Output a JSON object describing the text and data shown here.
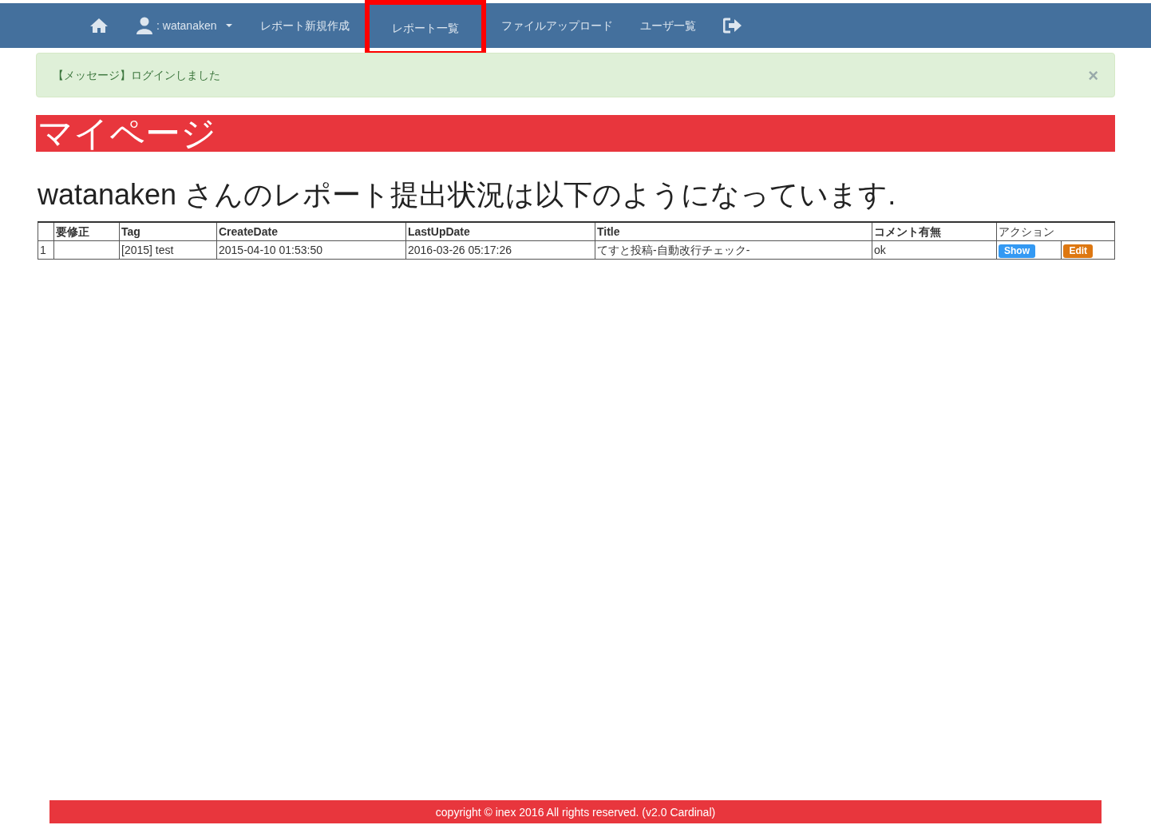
{
  "navbar": {
    "user": ": watanaken",
    "items": [
      {
        "label": "レポート新規作成",
        "highlighted": false
      },
      {
        "label": "レポート一覧",
        "highlighted": true
      },
      {
        "label": "ファイルアップロード",
        "highlighted": false
      },
      {
        "label": "ユーザ一覧",
        "highlighted": false
      }
    ]
  },
  "alert": {
    "message": "【メッセージ】ログインしました",
    "close": "×"
  },
  "page_title": "マイページ",
  "heading": "watanaken さんのレポート提出状況は以下のようになっています.",
  "table": {
    "columns": [
      "",
      "要修正",
      "Tag",
      "CreateDate",
      "LastUpDate",
      "Title",
      "コメント有無",
      "アクション"
    ],
    "rows": [
      {
        "cells": [
          "1",
          "",
          "[2015] test",
          "2015-04-10 01:53:50",
          "2016-03-26 05:17:26",
          "てすと投稿-自動改行チェック-",
          "ok"
        ],
        "actions": [
          {
            "label": "Show",
            "kind": "show"
          },
          {
            "label": "Edit",
            "kind": "edit"
          }
        ]
      }
    ]
  },
  "footer": "copyright © inex 2016 All rights reserved. (v2.0 Cardinal)"
}
